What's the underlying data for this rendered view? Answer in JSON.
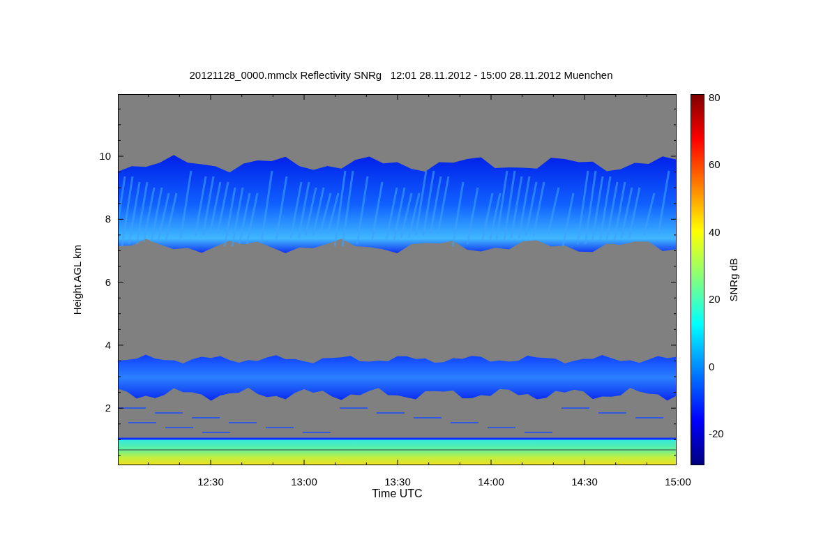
{
  "figure": {
    "title": "20121128_0000.mmclx Reflectivity SNRg   12:01 28.11.2012 - 15:00 28.11.2012 Muenchen",
    "y_axis": {
      "label": "Height AGL km",
      "ticks": [
        "10",
        "8",
        "6",
        "4",
        "2"
      ]
    },
    "x_axis": {
      "label": "Time UTC",
      "ticks": [
        "12:30",
        "13:00",
        "13:30",
        "14:00",
        "14:30",
        "15:00"
      ]
    },
    "colorbar": {
      "label": "SNRg dB",
      "ticks": [
        "80",
        "60",
        "40",
        "20",
        "0",
        "-20"
      ]
    }
  }
}
